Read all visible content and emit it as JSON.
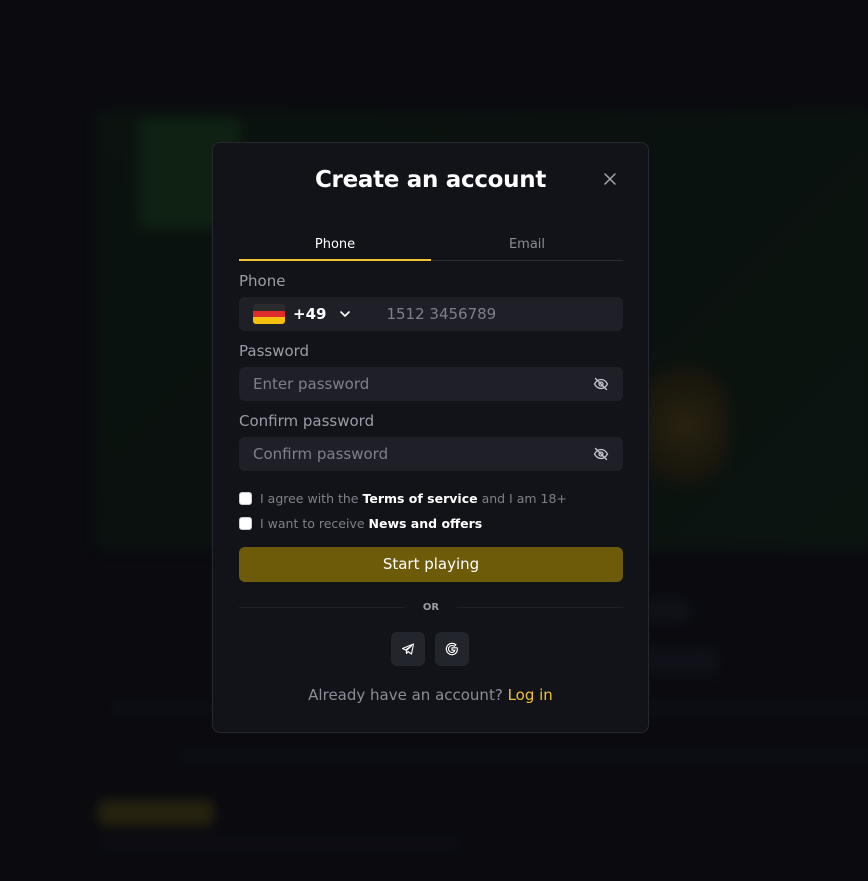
{
  "colors": {
    "accent": "#f2c230",
    "button_bg": "#6e5b0a",
    "modal_bg": "#121318",
    "input_bg": "#1f2027"
  },
  "modal": {
    "title": "Create an account",
    "close_icon": "close-icon",
    "tabs": [
      {
        "label": "Phone",
        "active": true
      },
      {
        "label": "Email",
        "active": false
      }
    ],
    "phone": {
      "label": "Phone",
      "country_flag": "germany-flag",
      "dial_code": "+49",
      "placeholder": "1512 3456789"
    },
    "password": {
      "label": "Password",
      "placeholder": "Enter password",
      "toggle_icon": "eye-off-icon"
    },
    "confirm_password": {
      "label": "Confirm password",
      "placeholder": "Confirm password",
      "toggle_icon": "eye-off-icon"
    },
    "terms": {
      "prefix": "I agree with the",
      "link": "Terms of service",
      "suffix": "and I am 18+",
      "checked": false
    },
    "news": {
      "prefix": "I want to receive",
      "link": "News and offers",
      "checked": false
    },
    "submit_label": "Start playing",
    "divider_label": "OR",
    "social": [
      {
        "icon": "telegram-icon"
      },
      {
        "icon": "google-icon"
      }
    ],
    "login_prompt": "Already have an account?",
    "login_link": "Log in"
  }
}
